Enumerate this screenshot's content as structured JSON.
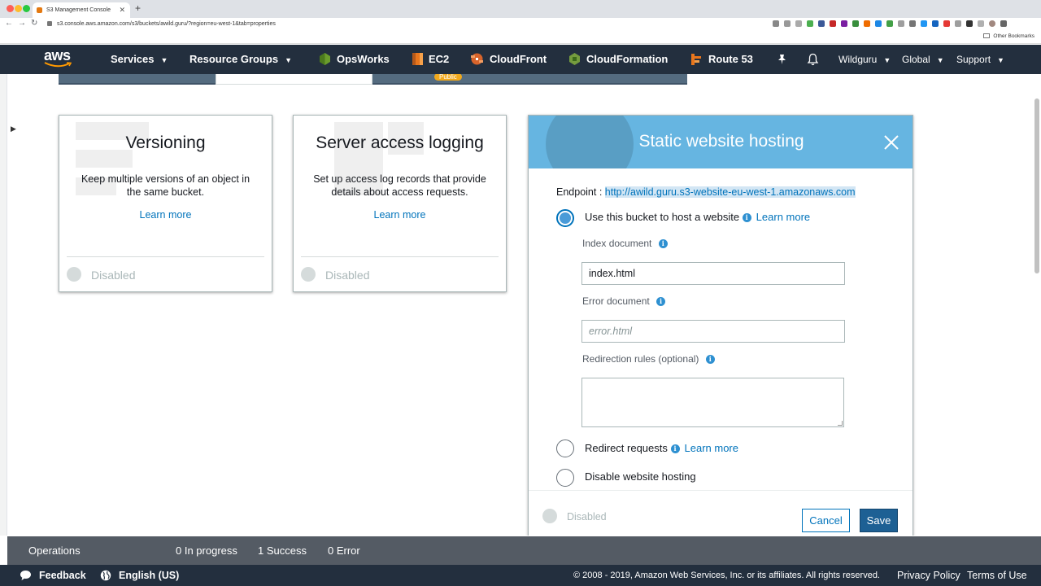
{
  "browser": {
    "tab_title": "S3 Management Console",
    "url": "s3.console.aws.amazon.com/s3/buckets/awild.guru/?region=eu-west-1&tab=properties",
    "other_bookmarks": "Other Bookmarks"
  },
  "awsnav": {
    "logo": "aws",
    "services": "Services",
    "resource_groups": "Resource Groups",
    "shortcuts": [
      "OpsWorks",
      "EC2",
      "CloudFront",
      "CloudFormation",
      "Route 53"
    ],
    "account": "Wildguru",
    "region": "Global",
    "support": "Support"
  },
  "tabs": {
    "badge": "Public"
  },
  "cards": [
    {
      "title": "Versioning",
      "description": "Keep multiple versions of an object in the same bucket.",
      "link": "Learn more",
      "status": "Disabled"
    },
    {
      "title": "Server access logging",
      "description": "Set up access log records that provide details about access requests.",
      "link": "Learn more",
      "status": "Disabled"
    }
  ],
  "panel": {
    "title": "Static website hosting",
    "endpoint_label": "Endpoint : ",
    "endpoint_url": "http://awild.guru.s3-website-eu-west-1.amazonaws.com",
    "option_host": "Use this bucket to host a website",
    "learn_more": "Learn more",
    "index_label": "Index document",
    "index_value": "index.html",
    "error_label": "Error document",
    "error_placeholder": "error.html",
    "redirection_label": "Redirection rules (optional)",
    "option_redirect": "Redirect requests",
    "option_disable": "Disable website hosting",
    "status": "Disabled",
    "cancel": "Cancel",
    "save": "Save",
    "selected_option": "host"
  },
  "operations": {
    "label": "Operations",
    "in_progress": "0 In progress",
    "success": "1 Success",
    "error": "0 Error"
  },
  "footer": {
    "feedback": "Feedback",
    "language": "English (US)",
    "copyright": "© 2008 - 2019, Amazon Web Services, Inc. or its affiliates. All rights reserved.",
    "privacy": "Privacy Policy",
    "terms": "Terms of Use"
  },
  "colors": {
    "nav_bg": "#232f3e",
    "panel_header": "#66b5e1",
    "link": "#0073bb",
    "save_button": "#1d6094",
    "ops_bar": "#545b64"
  }
}
